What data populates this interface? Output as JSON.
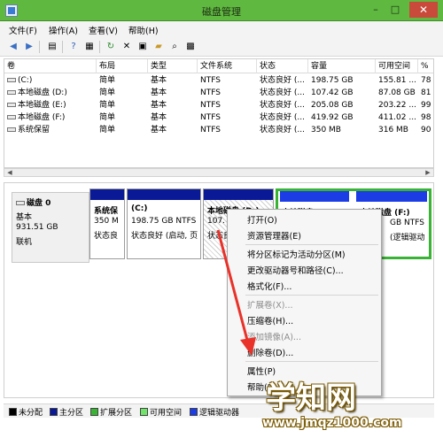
{
  "window": {
    "title": "磁盘管理",
    "minimize": "–",
    "maximize": "□",
    "close": "✕"
  },
  "menu": [
    "文件(F)",
    "操作(A)",
    "查看(V)",
    "帮助(H)"
  ],
  "table": {
    "headers": [
      "卷",
      "布局",
      "类型",
      "文件系统",
      "状态",
      "容量",
      "可用空间",
      "%"
    ],
    "rows": [
      [
        "(C:)",
        "简单",
        "基本",
        "NTFS",
        "状态良好 (...",
        "198.75 GB",
        "155.81 ...",
        "78"
      ],
      [
        "本地磁盘 (D:)",
        "简单",
        "基本",
        "NTFS",
        "状态良好 (...",
        "107.42 GB",
        "87.08 GB",
        "81"
      ],
      [
        "本地磁盘 (E:)",
        "简单",
        "基本",
        "NTFS",
        "状态良好 (...",
        "205.08 GB",
        "203.22 ...",
        "99"
      ],
      [
        "本地磁盘 (F:)",
        "简单",
        "基本",
        "NTFS",
        "状态良好 (...",
        "419.92 GB",
        "411.02 ...",
        "98"
      ],
      [
        "系统保留",
        "简单",
        "基本",
        "NTFS",
        "状态良好 (...",
        "350 MB",
        "316 MB",
        "90"
      ]
    ]
  },
  "disk": {
    "name": "磁盘 0",
    "type": "基本",
    "size": "931.51 GB",
    "status": "联机"
  },
  "partitions": [
    {
      "name": "系统保",
      "size": "350 M",
      "status": "状态良"
    },
    {
      "name": "(C:)",
      "size": "198.75 GB NTFS",
      "status": "状态良好 (启动, 页"
    },
    {
      "name": "本地磁盘 (D:)",
      "size": "107.",
      "status": "状态良"
    },
    {
      "name": "本地磁盘 (E:)",
      "size": "",
      "status": ""
    },
    {
      "name": "本地磁盘 (F:)",
      "size": "GB NTFS",
      "status": "(逻辑驱动"
    }
  ],
  "context_menu": [
    {
      "label": "打开(O)",
      "enabled": true
    },
    {
      "label": "资源管理器(E)",
      "enabled": true
    },
    {
      "label": "将分区标记为活动分区(M)",
      "enabled": true
    },
    {
      "label": "更改驱动器号和路径(C)...",
      "enabled": true
    },
    {
      "label": "格式化(F)...",
      "enabled": true
    },
    {
      "label": "扩展卷(X)...",
      "enabled": false
    },
    {
      "label": "压缩卷(H)...",
      "enabled": true
    },
    {
      "label": "添加镜像(A)...",
      "enabled": false
    },
    {
      "label": "删除卷(D)...",
      "enabled": true
    },
    {
      "label": "属性(P)",
      "enabled": true
    },
    {
      "label": "帮助(H)",
      "enabled": true
    }
  ],
  "legend": [
    {
      "label": "未分配",
      "color": "#000000"
    },
    {
      "label": "主分区",
      "color": "#0a1a96"
    },
    {
      "label": "扩展分区",
      "color": "#39b334"
    },
    {
      "label": "可用空间",
      "color": "#6fe36a"
    },
    {
      "label": "逻辑驱动器",
      "color": "#1c3ce6"
    }
  ],
  "watermark": {
    "main": "学知网",
    "url": "www.jmqz1000.com"
  }
}
